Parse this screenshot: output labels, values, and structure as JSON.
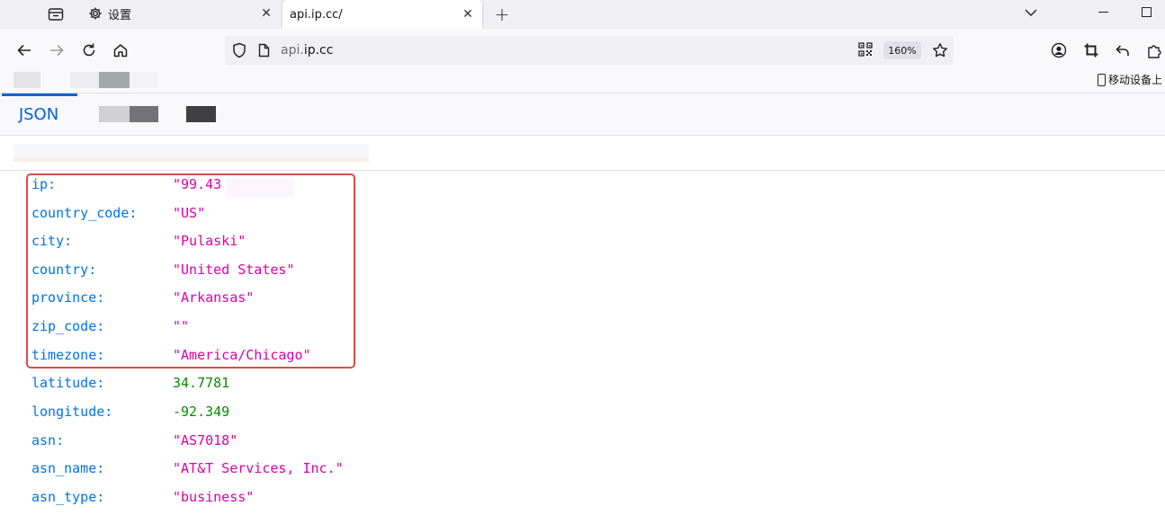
{
  "browser": {
    "tabs": [
      {
        "title": "设置",
        "icon": "gear-icon",
        "active": false
      },
      {
        "title": "api.ip.cc/",
        "icon": "none",
        "active": true
      }
    ],
    "url": {
      "subdomain": "api.",
      "domain": "ip.cc"
    },
    "zoom": "160%",
    "bookmarks": {
      "mobile_label": "移动设备上"
    }
  },
  "viewer": {
    "tabs": [
      {
        "label": "JSON",
        "active": true
      }
    ]
  },
  "json": [
    {
      "key": "ip:",
      "value": "\"99.43",
      "type": "str"
    },
    {
      "key": "country_code:",
      "value": "\"US\"",
      "type": "str"
    },
    {
      "key": "city:",
      "value": "\"Pulaski\"",
      "type": "str"
    },
    {
      "key": "country:",
      "value": "\"United States\"",
      "type": "str"
    },
    {
      "key": "province:",
      "value": "\"Arkansas\"",
      "type": "str"
    },
    {
      "key": "zip_code:",
      "value": "\"\"",
      "type": "str"
    },
    {
      "key": "timezone:",
      "value": "\"America/Chicago\"",
      "type": "str"
    },
    {
      "key": "latitude:",
      "value": "34.7781",
      "type": "num"
    },
    {
      "key": "longitude:",
      "value": "-92.349",
      "type": "num"
    },
    {
      "key": "asn:",
      "value": "\"AS7018\"",
      "type": "str"
    },
    {
      "key": "asn_name:",
      "value": "\"AT&T Services, Inc.\"",
      "type": "str"
    },
    {
      "key": "asn_type:",
      "value": "\"business\"",
      "type": "str"
    }
  ],
  "colors": {
    "key": "#0074e8",
    "string": "#dd00a9",
    "number": "#058b00",
    "accent": "#0060df",
    "highlight": "#e04a4a"
  }
}
